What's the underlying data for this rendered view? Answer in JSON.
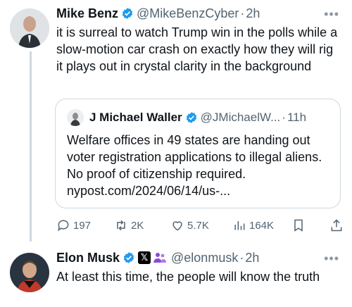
{
  "tweet1": {
    "name": "Mike Benz",
    "handle": "@MikeBenzCyber",
    "dot": "·",
    "time": "2h",
    "more": "•••",
    "text": "it is surreal to watch Trump win in the polls while a slow-motion car crash on exactly how they will rig it plays out in crystal clarity in the background",
    "quote": {
      "name": "J Michael Waller",
      "handle": "@JMichaelW...",
      "dot": "·",
      "time": "11h",
      "text": "Welfare offices in 49 states are handing out voter registration applications to illegal aliens. No proof of citizenship required. nypost.com/2024/06/14/us-..."
    },
    "actions": {
      "replies": "197",
      "reposts": "2K",
      "likes": "5.7K",
      "views": "164K"
    }
  },
  "tweet2": {
    "name": "Elon Musk",
    "handle": "@elonmusk",
    "dot": "·",
    "time": "2h",
    "more": "•••",
    "x_badge": "𝕏",
    "text": "At least this time, the people will know the truth"
  },
  "colors": {
    "verified": "#1d9bf0",
    "secondary": "#536471",
    "border": "#cfd9de",
    "affiliate": "#8a4bd6"
  },
  "icons": [
    "verified-badge-icon",
    "more-icon",
    "reply-icon",
    "repost-icon",
    "like-icon",
    "views-icon",
    "bookmark-icon",
    "share-icon",
    "x-affiliate-icon",
    "group-icon"
  ]
}
